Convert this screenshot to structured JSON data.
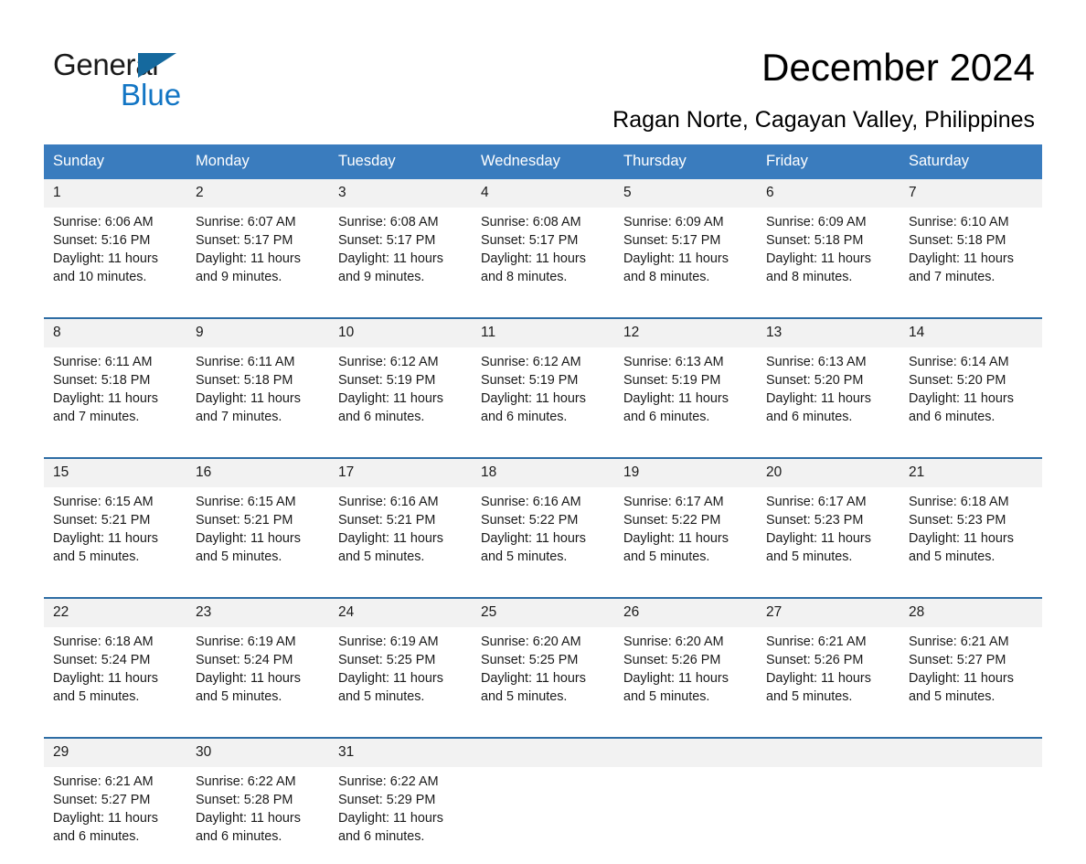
{
  "brand": {
    "name_part1": "General",
    "name_part2": "Blue",
    "accent_color": "#1275c4",
    "triangle_color": "#15699e"
  },
  "header": {
    "month_title": "December 2024",
    "location": "Ragan Norte, Cagayan Valley, Philippines"
  },
  "theme": {
    "header_row_bg": "#3a7cbe",
    "date_band_bg": "#f2f2f2",
    "separator_color": "#2e6da4",
    "page_bg": "#ffffff"
  },
  "weekday_headers": [
    "Sunday",
    "Monday",
    "Tuesday",
    "Wednesday",
    "Thursday",
    "Friday",
    "Saturday"
  ],
  "weeks": [
    {
      "days": [
        {
          "date": "1",
          "sunrise": "Sunrise: 6:06 AM",
          "sunset": "Sunset: 5:16 PM",
          "daylight_line1": "Daylight: 11 hours",
          "daylight_line2": "and 10 minutes."
        },
        {
          "date": "2",
          "sunrise": "Sunrise: 6:07 AM",
          "sunset": "Sunset: 5:17 PM",
          "daylight_line1": "Daylight: 11 hours",
          "daylight_line2": "and 9 minutes."
        },
        {
          "date": "3",
          "sunrise": "Sunrise: 6:08 AM",
          "sunset": "Sunset: 5:17 PM",
          "daylight_line1": "Daylight: 11 hours",
          "daylight_line2": "and 9 minutes."
        },
        {
          "date": "4",
          "sunrise": "Sunrise: 6:08 AM",
          "sunset": "Sunset: 5:17 PM",
          "daylight_line1": "Daylight: 11 hours",
          "daylight_line2": "and 8 minutes."
        },
        {
          "date": "5",
          "sunrise": "Sunrise: 6:09 AM",
          "sunset": "Sunset: 5:17 PM",
          "daylight_line1": "Daylight: 11 hours",
          "daylight_line2": "and 8 minutes."
        },
        {
          "date": "6",
          "sunrise": "Sunrise: 6:09 AM",
          "sunset": "Sunset: 5:18 PM",
          "daylight_line1": "Daylight: 11 hours",
          "daylight_line2": "and 8 minutes."
        },
        {
          "date": "7",
          "sunrise": "Sunrise: 6:10 AM",
          "sunset": "Sunset: 5:18 PM",
          "daylight_line1": "Daylight: 11 hours",
          "daylight_line2": "and 7 minutes."
        }
      ]
    },
    {
      "days": [
        {
          "date": "8",
          "sunrise": "Sunrise: 6:11 AM",
          "sunset": "Sunset: 5:18 PM",
          "daylight_line1": "Daylight: 11 hours",
          "daylight_line2": "and 7 minutes."
        },
        {
          "date": "9",
          "sunrise": "Sunrise: 6:11 AM",
          "sunset": "Sunset: 5:18 PM",
          "daylight_line1": "Daylight: 11 hours",
          "daylight_line2": "and 7 minutes."
        },
        {
          "date": "10",
          "sunrise": "Sunrise: 6:12 AM",
          "sunset": "Sunset: 5:19 PM",
          "daylight_line1": "Daylight: 11 hours",
          "daylight_line2": "and 6 minutes."
        },
        {
          "date": "11",
          "sunrise": "Sunrise: 6:12 AM",
          "sunset": "Sunset: 5:19 PM",
          "daylight_line1": "Daylight: 11 hours",
          "daylight_line2": "and 6 minutes."
        },
        {
          "date": "12",
          "sunrise": "Sunrise: 6:13 AM",
          "sunset": "Sunset: 5:19 PM",
          "daylight_line1": "Daylight: 11 hours",
          "daylight_line2": "and 6 minutes."
        },
        {
          "date": "13",
          "sunrise": "Sunrise: 6:13 AM",
          "sunset": "Sunset: 5:20 PM",
          "daylight_line1": "Daylight: 11 hours",
          "daylight_line2": "and 6 minutes."
        },
        {
          "date": "14",
          "sunrise": "Sunrise: 6:14 AM",
          "sunset": "Sunset: 5:20 PM",
          "daylight_line1": "Daylight: 11 hours",
          "daylight_line2": "and 6 minutes."
        }
      ]
    },
    {
      "days": [
        {
          "date": "15",
          "sunrise": "Sunrise: 6:15 AM",
          "sunset": "Sunset: 5:21 PM",
          "daylight_line1": "Daylight: 11 hours",
          "daylight_line2": "and 5 minutes."
        },
        {
          "date": "16",
          "sunrise": "Sunrise: 6:15 AM",
          "sunset": "Sunset: 5:21 PM",
          "daylight_line1": "Daylight: 11 hours",
          "daylight_line2": "and 5 minutes."
        },
        {
          "date": "17",
          "sunrise": "Sunrise: 6:16 AM",
          "sunset": "Sunset: 5:21 PM",
          "daylight_line1": "Daylight: 11 hours",
          "daylight_line2": "and 5 minutes."
        },
        {
          "date": "18",
          "sunrise": "Sunrise: 6:16 AM",
          "sunset": "Sunset: 5:22 PM",
          "daylight_line1": "Daylight: 11 hours",
          "daylight_line2": "and 5 minutes."
        },
        {
          "date": "19",
          "sunrise": "Sunrise: 6:17 AM",
          "sunset": "Sunset: 5:22 PM",
          "daylight_line1": "Daylight: 11 hours",
          "daylight_line2": "and 5 minutes."
        },
        {
          "date": "20",
          "sunrise": "Sunrise: 6:17 AM",
          "sunset": "Sunset: 5:23 PM",
          "daylight_line1": "Daylight: 11 hours",
          "daylight_line2": "and 5 minutes."
        },
        {
          "date": "21",
          "sunrise": "Sunrise: 6:18 AM",
          "sunset": "Sunset: 5:23 PM",
          "daylight_line1": "Daylight: 11 hours",
          "daylight_line2": "and 5 minutes."
        }
      ]
    },
    {
      "days": [
        {
          "date": "22",
          "sunrise": "Sunrise: 6:18 AM",
          "sunset": "Sunset: 5:24 PM",
          "daylight_line1": "Daylight: 11 hours",
          "daylight_line2": "and 5 minutes."
        },
        {
          "date": "23",
          "sunrise": "Sunrise: 6:19 AM",
          "sunset": "Sunset: 5:24 PM",
          "daylight_line1": "Daylight: 11 hours",
          "daylight_line2": "and 5 minutes."
        },
        {
          "date": "24",
          "sunrise": "Sunrise: 6:19 AM",
          "sunset": "Sunset: 5:25 PM",
          "daylight_line1": "Daylight: 11 hours",
          "daylight_line2": "and 5 minutes."
        },
        {
          "date": "25",
          "sunrise": "Sunrise: 6:20 AM",
          "sunset": "Sunset: 5:25 PM",
          "daylight_line1": "Daylight: 11 hours",
          "daylight_line2": "and 5 minutes."
        },
        {
          "date": "26",
          "sunrise": "Sunrise: 6:20 AM",
          "sunset": "Sunset: 5:26 PM",
          "daylight_line1": "Daylight: 11 hours",
          "daylight_line2": "and 5 minutes."
        },
        {
          "date": "27",
          "sunrise": "Sunrise: 6:21 AM",
          "sunset": "Sunset: 5:26 PM",
          "daylight_line1": "Daylight: 11 hours",
          "daylight_line2": "and 5 minutes."
        },
        {
          "date": "28",
          "sunrise": "Sunrise: 6:21 AM",
          "sunset": "Sunset: 5:27 PM",
          "daylight_line1": "Daylight: 11 hours",
          "daylight_line2": "and 5 minutes."
        }
      ]
    },
    {
      "days": [
        {
          "date": "29",
          "sunrise": "Sunrise: 6:21 AM",
          "sunset": "Sunset: 5:27 PM",
          "daylight_line1": "Daylight: 11 hours",
          "daylight_line2": "and 6 minutes."
        },
        {
          "date": "30",
          "sunrise": "Sunrise: 6:22 AM",
          "sunset": "Sunset: 5:28 PM",
          "daylight_line1": "Daylight: 11 hours",
          "daylight_line2": "and 6 minutes."
        },
        {
          "date": "31",
          "sunrise": "Sunrise: 6:22 AM",
          "sunset": "Sunset: 5:29 PM",
          "daylight_line1": "Daylight: 11 hours",
          "daylight_line2": "and 6 minutes."
        },
        {
          "date": "",
          "sunrise": "",
          "sunset": "",
          "daylight_line1": "",
          "daylight_line2": ""
        },
        {
          "date": "",
          "sunrise": "",
          "sunset": "",
          "daylight_line1": "",
          "daylight_line2": ""
        },
        {
          "date": "",
          "sunrise": "",
          "sunset": "",
          "daylight_line1": "",
          "daylight_line2": ""
        },
        {
          "date": "",
          "sunrise": "",
          "sunset": "",
          "daylight_line1": "",
          "daylight_line2": ""
        }
      ]
    }
  ]
}
